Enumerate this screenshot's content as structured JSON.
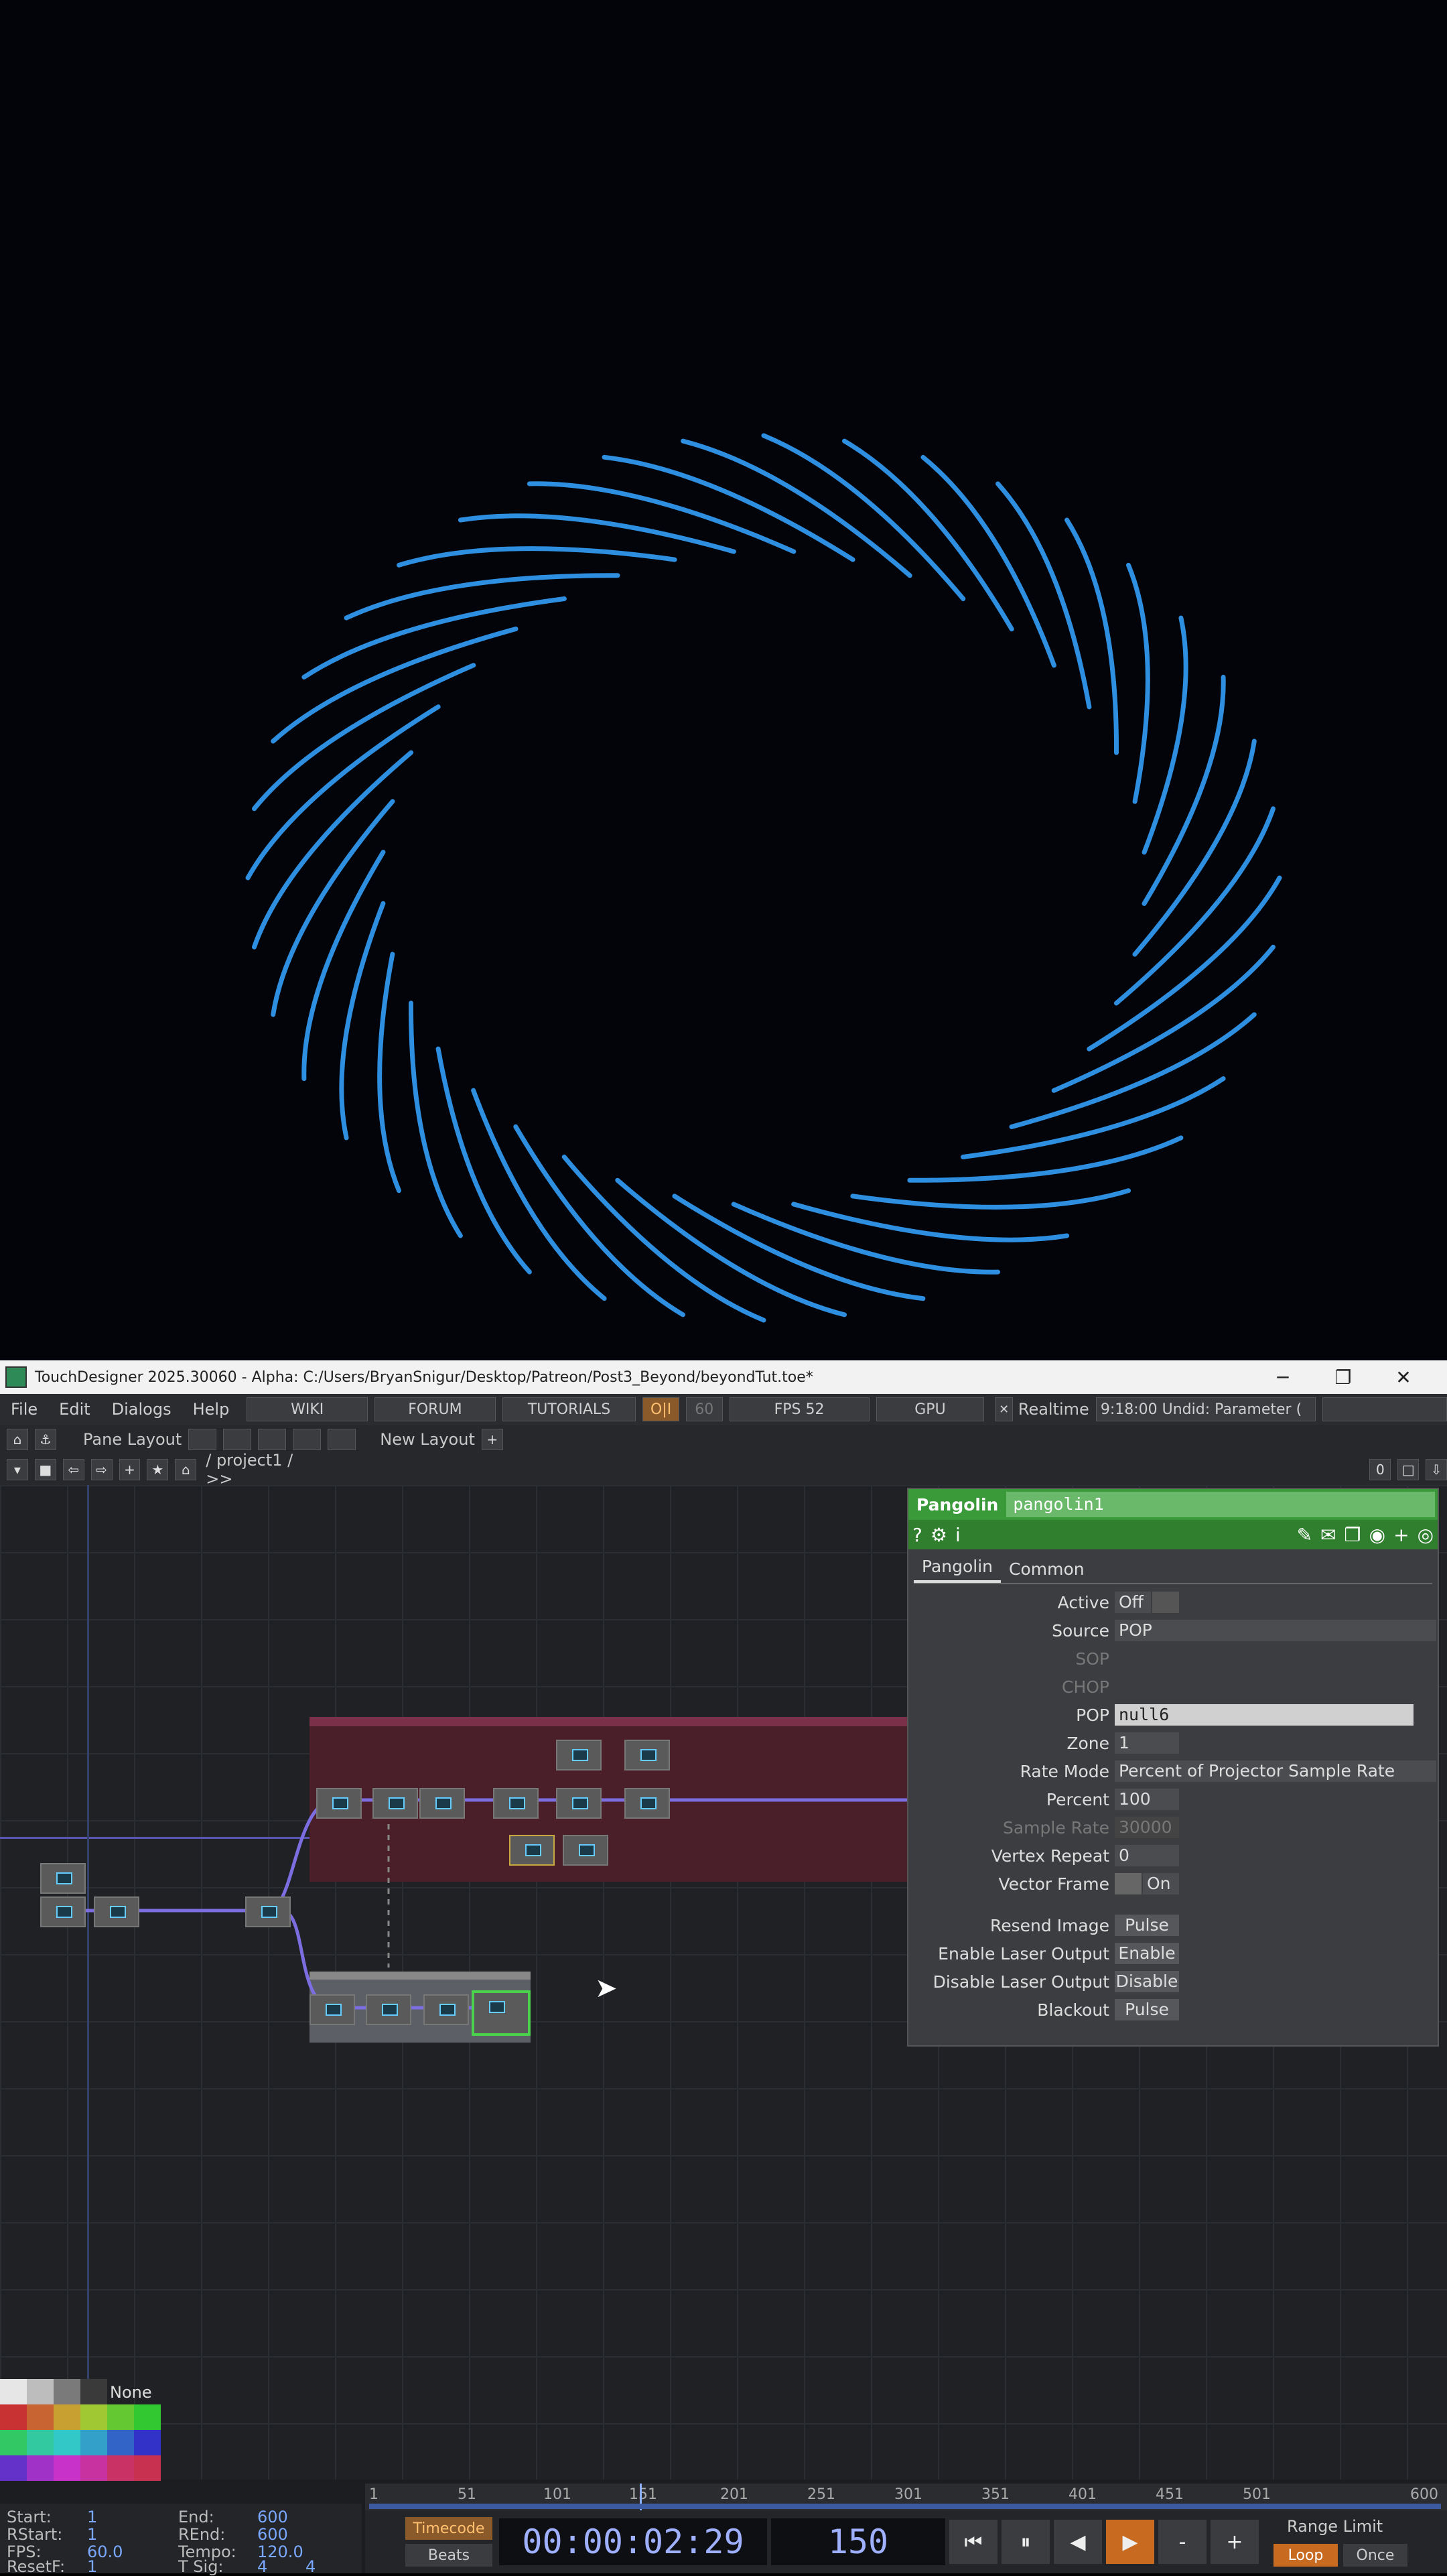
{
  "window": {
    "title": "TouchDesigner 2025.30060 - Alpha: C:/Users/BryanSnigur/Desktop/Patreon/Post3_Beyond/beyondTut.toe*",
    "minimize": "─",
    "restore": "❐",
    "close": "✕"
  },
  "menu": {
    "items": [
      "File",
      "Edit",
      "Dialogs",
      "Help"
    ],
    "wiki": "WIKI",
    "forum": "FORUM",
    "tutorials": "TUTORIALS",
    "oi": "O|I",
    "sixty": "60",
    "fps": "FPS  52",
    "gpu": "GPU",
    "realtime_check": "✕",
    "realtime": "Realtime",
    "status": "9:18:00 Undid: Parameter (",
    "pane_layout": "Pane Layout",
    "new_layout": "New Layout",
    "plus": "+",
    "path": "/ project1 / >>",
    "zero": "0"
  },
  "params": {
    "op_type": "Pangolin",
    "op_name": "pangolin1",
    "tabs": [
      "Pangolin",
      "Common"
    ],
    "active": {
      "label": "Active",
      "value": "Off"
    },
    "source": {
      "label": "Source",
      "value": "POP"
    },
    "sop": {
      "label": "SOP"
    },
    "chop": {
      "label": "CHOP"
    },
    "pop": {
      "label": "POP",
      "value": "null6"
    },
    "zone": {
      "label": "Zone",
      "value": "1"
    },
    "rate_mode": {
      "label": "Rate Mode",
      "value": "Percent of Projector Sample Rate"
    },
    "percent": {
      "label": "Percent",
      "value": "100"
    },
    "sample_rate": {
      "label": "Sample Rate",
      "value": "30000"
    },
    "vertex_repeat": {
      "label": "Vertex Repeat",
      "value": "0"
    },
    "vector_frame": {
      "label": "Vector Frame",
      "value": "On"
    },
    "resend": {
      "label": "Resend Image",
      "value": "Pulse"
    },
    "enable": {
      "label": "Enable Laser Output",
      "value": "Enable"
    },
    "disable": {
      "label": "Disable Laser Output",
      "value": "Disable"
    },
    "blackout": {
      "label": "Blackout",
      "value": "Pulse"
    }
  },
  "palette": {
    "none": "None"
  },
  "stats": {
    "start_l": "Start:",
    "start_v": "1",
    "end_l": "End:",
    "end_v": "600",
    "rstart_l": "RStart:",
    "rstart_v": "1",
    "rend_l": "REnd:",
    "rend_v": "600",
    "fps_l": "FPS:",
    "fps_v": "60.0",
    "tempo_l": "Tempo:",
    "tempo_v": "120.0",
    "resetf_l": "ResetF:",
    "resetf_v": "1",
    "tsig_l": "T Sig:",
    "tsig_v1": "4",
    "tsig_v2": "4"
  },
  "timeline": {
    "ticks": [
      "1",
      "51",
      "101",
      "151",
      "201",
      "251",
      "301",
      "351",
      "401",
      "451",
      "501",
      "600"
    ],
    "timecode": "Timecode",
    "beats": "Beats",
    "time": "00:00:02:29",
    "frame": "150",
    "range_limit": "Range Limit",
    "loop": "Loop",
    "once": "Once",
    "minus": "-",
    "plus": "+"
  },
  "colors": {
    "laser": "#2e8fe0",
    "accent_green": "#3a9a3a",
    "op_green": "#4bd14b"
  }
}
